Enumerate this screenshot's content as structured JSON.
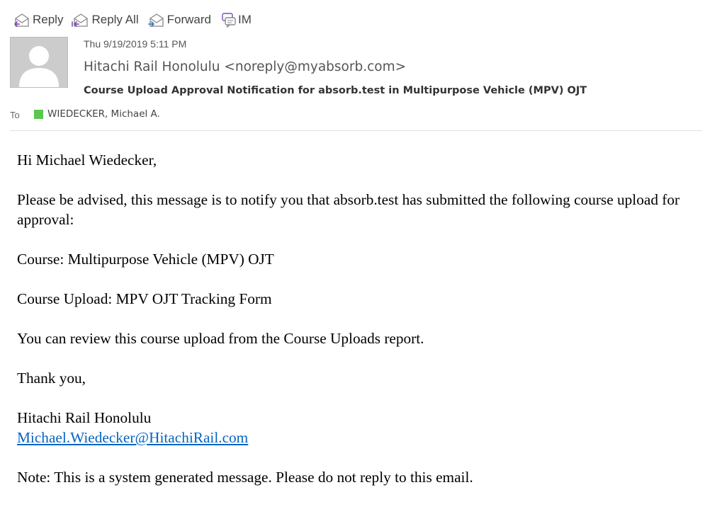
{
  "toolbar": {
    "reply_label": "Reply",
    "reply_all_label": "Reply All",
    "forward_label": "Forward",
    "im_label": "IM"
  },
  "message": {
    "date": "Thu 9/19/2019 5:11 PM",
    "sender": "Hitachi Rail Honolulu <noreply@myabsorb.com>",
    "subject": "Course Upload Approval Notification for absorb.test in Multipurpose Vehicle (MPV) OJT",
    "to_label": "To",
    "recipient": "WIEDECKER, Michael A.",
    "presence_color": "#5ac84e"
  },
  "body": {
    "greeting": "Hi Michael Wiedecker,",
    "intro": "Please be advised, this message is to notify you that absorb.test has submitted the following course upload for approval:",
    "course": "Course: Multipurpose Vehicle (MPV) OJT",
    "course_upload": "Course Upload: MPV OJT Tracking Form",
    "review": "You can review this course upload from the Course Uploads report.",
    "thanks": "Thank you,",
    "signature_name": "Hitachi Rail Honolulu",
    "signature_email": "Michael.Wiedecker@HitachiRail.com",
    "note": "Note: This is a system generated message. Please do not reply to this email."
  },
  "colors": {
    "link": "#0563c1",
    "accent_purple": "#7b4fb3",
    "accent_blue": "#3c7fc8"
  }
}
